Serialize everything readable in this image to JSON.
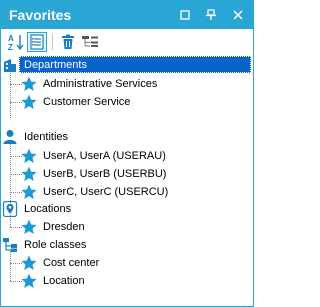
{
  "window": {
    "title": "Favorites"
  },
  "colors": {
    "titlebar": "#2aa6d5",
    "selection": "#0a63c9",
    "star": "#1a9ad6"
  },
  "window_controls": [
    {
      "name": "restore-button",
      "icon": "square-icon"
    },
    {
      "name": "pin-button",
      "icon": "pin-icon"
    },
    {
      "name": "close-button",
      "icon": "close-icon"
    }
  ],
  "toolbar": [
    {
      "name": "sort-az-button",
      "icon": "sort-az-icon"
    },
    {
      "name": "list-view-button",
      "icon": "list-view-icon",
      "pressed": true
    },
    {
      "name": "delete-button",
      "icon": "trash-icon"
    },
    {
      "name": "collapse-button",
      "icon": "collapse-tree-icon"
    }
  ],
  "tree": {
    "groups": [
      {
        "label": "Departments",
        "icon": "building-icon",
        "selected": true,
        "items": [
          "Administrative Services",
          "Customer Service"
        ]
      },
      {
        "label": "Identities",
        "icon": "person-icon",
        "items": [
          "UserA, UserA (USERAU)",
          "UserB, UserB (USERBU)",
          "UserC, UserC (USERCU)"
        ]
      },
      {
        "label": "Locations",
        "icon": "location-pin-icon",
        "items": [
          "Dresden"
        ]
      },
      {
        "label": "Role classes",
        "icon": "role-classes-icon",
        "items": [
          "Cost center",
          "Location"
        ]
      }
    ]
  }
}
